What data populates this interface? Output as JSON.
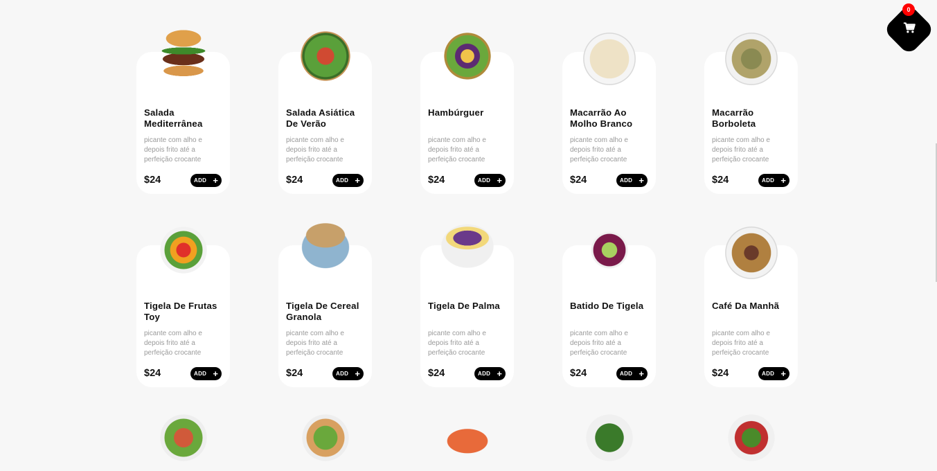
{
  "cart": {
    "count": "0",
    "icon": "cart-icon"
  },
  "products": [
    {
      "name": "Salada Mediterrânea",
      "desc": "picante com alho e depois frito até a perfeição crocante",
      "price": "$24",
      "add": "ADD",
      "img": "burger"
    },
    {
      "name": "Salada Asiática De Verão",
      "desc": "picante com alho e depois frito até a perfeição crocante",
      "price": "$24",
      "add": "ADD",
      "img": "salad1"
    },
    {
      "name": "Hambúrguer",
      "desc": "picante com alho e depois frito até a perfeição crocante",
      "price": "$24",
      "add": "ADD",
      "img": "salad2"
    },
    {
      "name": "Macarrão Ao Molho Branco",
      "desc": "picante com alho e depois frito até a perfeição crocante",
      "price": "$24",
      "add": "ADD",
      "img": "pasta1"
    },
    {
      "name": "Macarrão Borboleta",
      "desc": "picante com alho e depois frito até a perfeição crocante",
      "price": "$24",
      "add": "ADD",
      "img": "pasta2"
    },
    {
      "name": "Tigela De Frutas Toy",
      "desc": "picante com alho e depois frito até a perfeição crocante",
      "price": "$24",
      "add": "ADD",
      "img": "fruit"
    },
    {
      "name": "Tigela De Cereal Granola",
      "desc": "picante com alho e depois frito até a perfeição crocante",
      "price": "$24",
      "add": "ADD",
      "img": "granola"
    },
    {
      "name": "Tigela De Palma",
      "desc": "picante com alho e depois frito até a perfeição crocante",
      "price": "$24",
      "add": "ADD",
      "img": "palma"
    },
    {
      "name": "Batido De Tigela",
      "desc": "picante com alho e depois frito até a perfeição crocante",
      "price": "$24",
      "add": "ADD",
      "img": "batido"
    },
    {
      "name": "Café Da Manhã",
      "desc": "picante com alho e depois frito até a perfeição crocante",
      "price": "$24",
      "add": "ADD",
      "img": "cafe"
    }
  ]
}
